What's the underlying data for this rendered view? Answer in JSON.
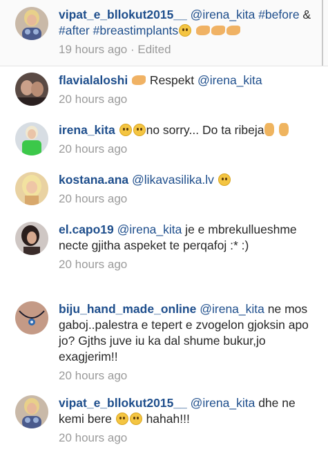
{
  "comments": [
    {
      "username": "vipat_e_bllokut2015__",
      "parts": [
        {
          "t": "link",
          "v": "@irena_kita"
        },
        {
          "t": "text",
          "v": " "
        },
        {
          "t": "link",
          "v": "#before"
        },
        {
          "t": "text",
          "v": " & "
        },
        {
          "t": "link",
          "v": "#after"
        },
        {
          "t": "text",
          "v": " "
        },
        {
          "t": "link",
          "v": "#breastimplants"
        },
        {
          "t": "emoji",
          "v": "face"
        },
        {
          "t": "text",
          "v": " "
        },
        {
          "t": "emoji",
          "v": "muscle"
        },
        {
          "t": "emoji",
          "v": "muscle"
        },
        {
          "t": "emoji",
          "v": "muscle"
        }
      ],
      "time": "19 hours ago · Edited",
      "avatar": "woman-blonde-avatar"
    },
    {
      "username": "flavialaloshi",
      "parts": [
        {
          "t": "emoji",
          "v": "muscle"
        },
        {
          "t": "text",
          "v": " Respekt "
        },
        {
          "t": "link",
          "v": "@irena_kita"
        }
      ],
      "time": "20 hours ago",
      "avatar": "couple-avatar"
    },
    {
      "username": "irena_kita",
      "parts": [
        {
          "t": "emoji",
          "v": "face"
        },
        {
          "t": "emoji",
          "v": "face"
        },
        {
          "t": "text",
          "v": "no sorry... Do ta ribeja"
        },
        {
          "t": "emoji",
          "v": "peace"
        },
        {
          "t": "text",
          "v": " "
        },
        {
          "t": "emoji",
          "v": "peace"
        }
      ],
      "time": "20 hours ago",
      "avatar": "woman-green-avatar"
    },
    {
      "username": "kostana.ana",
      "parts": [
        {
          "t": "link",
          "v": "@likavasilika.lv"
        },
        {
          "t": "text",
          "v": " "
        },
        {
          "t": "emoji",
          "v": "face"
        }
      ],
      "time": "20 hours ago",
      "avatar": "blonde-selfie-avatar"
    },
    {
      "username": "el.capo19",
      "parts": [
        {
          "t": "link",
          "v": "@irena_kita"
        },
        {
          "t": "text",
          "v": "  je e mbrekullueshme necte gjitha aspeket te perqafoj :* :)"
        }
      ],
      "time": "20 hours ago",
      "avatar": "dark-hair-avatar"
    },
    {
      "username": "biju_hand_made_online",
      "parts": [
        {
          "t": "link",
          "v": "@irena_kita"
        },
        {
          "t": "text",
          "v": " ne mos gaboj..palestra e tepert e zvogelon gjoksin apo jo? Gjths juve iu ka dal shume bukur,jo exagjerim!!"
        }
      ],
      "time": "20 hours ago",
      "avatar": "necklace-avatar"
    },
    {
      "username": "vipat_e_bllokut2015__",
      "parts": [
        {
          "t": "link",
          "v": "@irena_kita"
        },
        {
          "t": "text",
          "v": " dhe ne kemi bere "
        },
        {
          "t": "emoji",
          "v": "face"
        },
        {
          "t": "emoji",
          "v": "face"
        },
        {
          "t": "text",
          "v": " hahah!!!"
        }
      ],
      "time": "20 hours ago",
      "avatar": "woman-blonde-avatar"
    }
  ],
  "colors": {
    "username": "#1e4e8c",
    "link": "#1e4e8c",
    "text": "#262626",
    "timestamp": "#9a9a9a",
    "caption_background": "#fafafa"
  }
}
